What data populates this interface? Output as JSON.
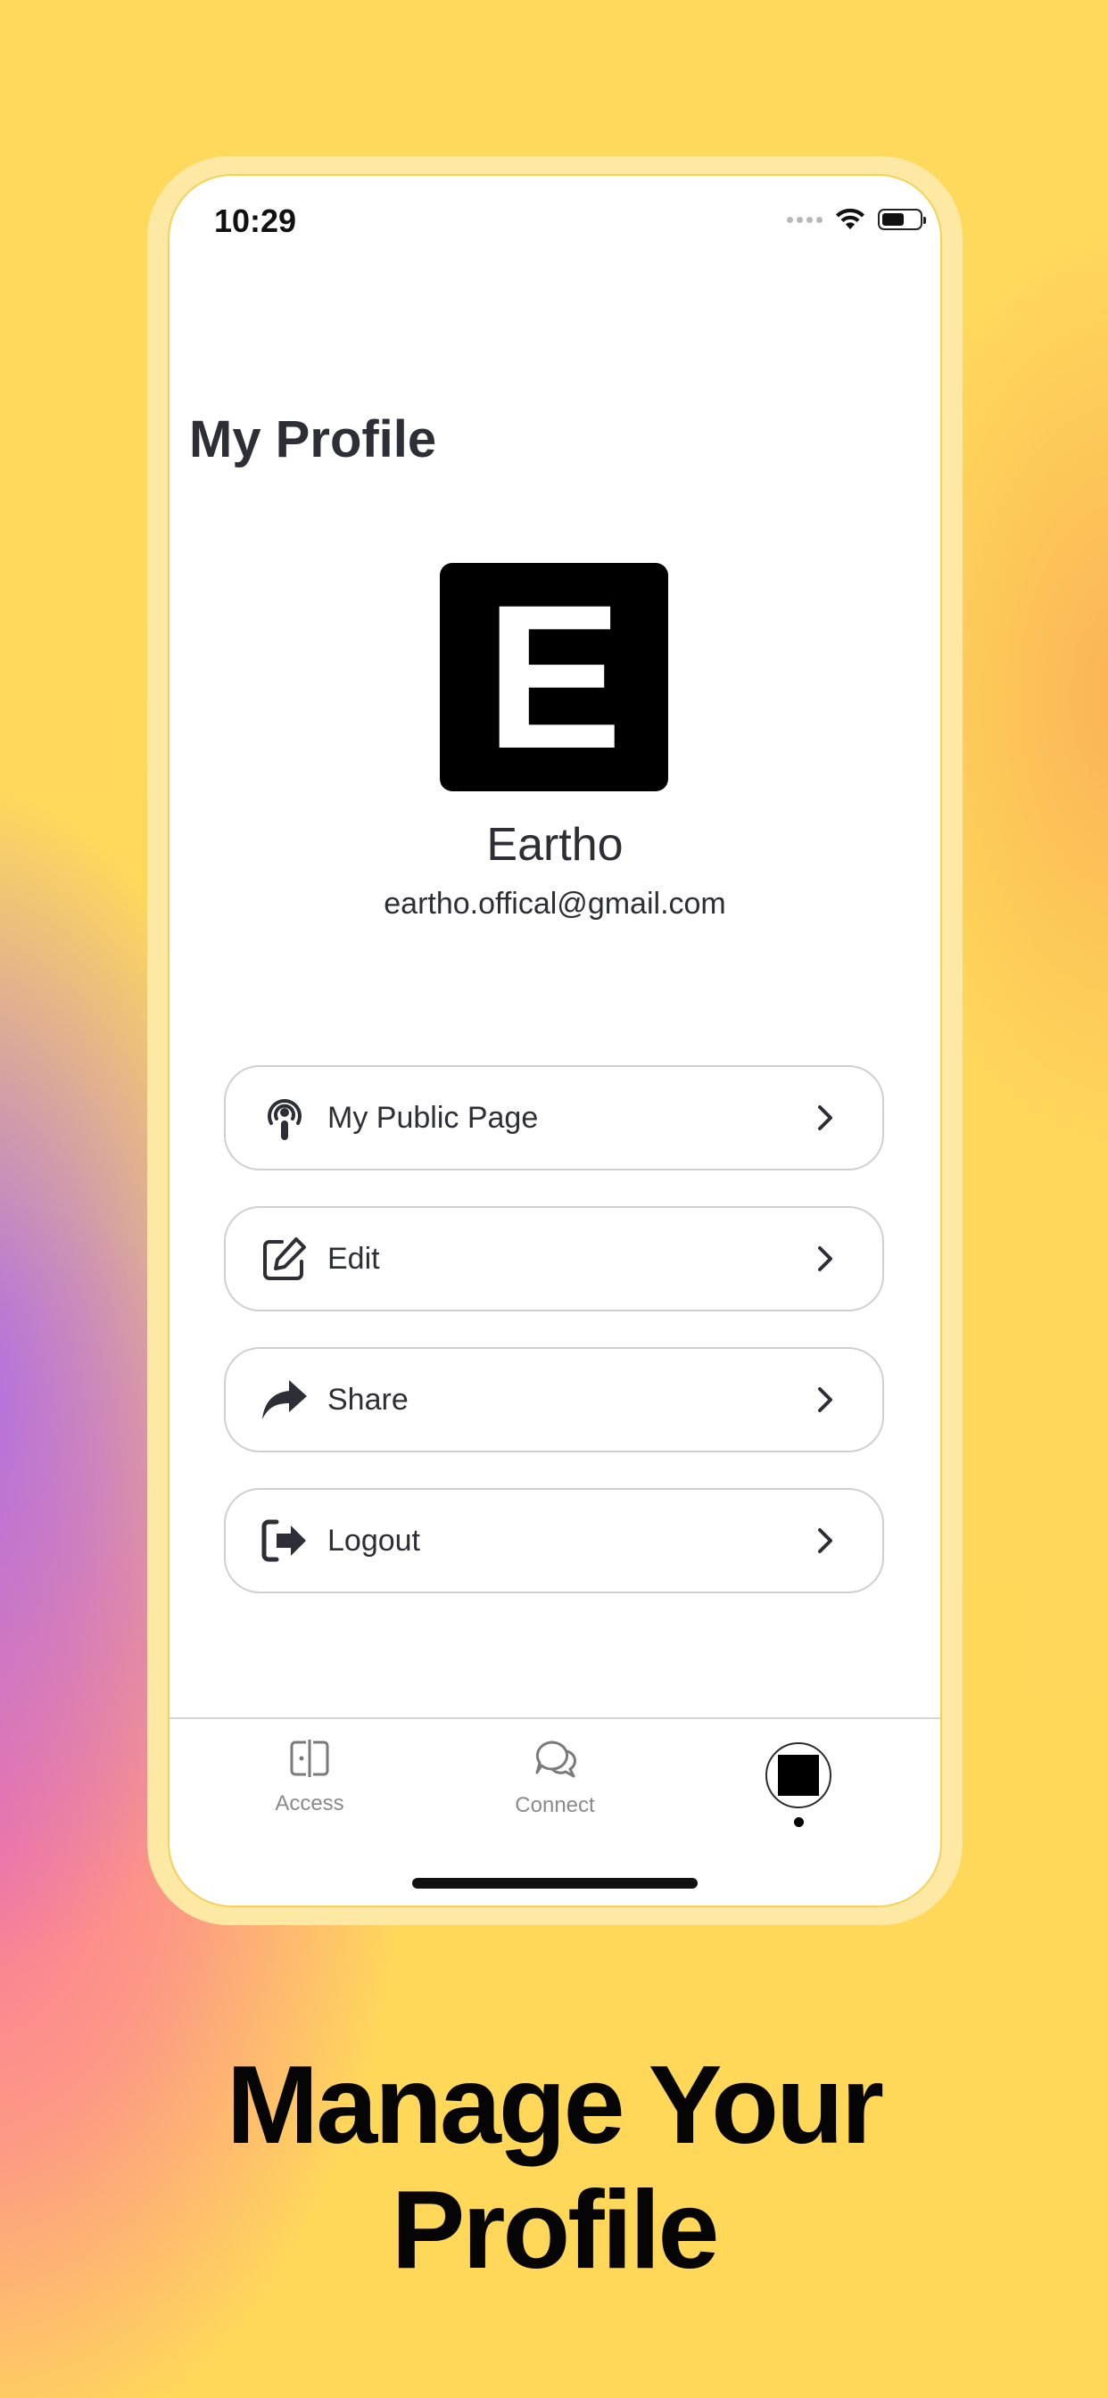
{
  "status_bar": {
    "time": "10:29"
  },
  "page": {
    "title": "My Profile"
  },
  "profile": {
    "avatar_letter": "E",
    "name": "Eartho",
    "email": "eartho.offical@gmail.com"
  },
  "menu": {
    "items": [
      {
        "label": "My Public Page",
        "icon": "podcast-broadcast-icon"
      },
      {
        "label": "Edit",
        "icon": "edit-pencil-icon"
      },
      {
        "label": "Share",
        "icon": "share-arrow-icon"
      },
      {
        "label": "Logout",
        "icon": "logout-icon"
      }
    ]
  },
  "tab_bar": {
    "tabs": [
      {
        "label": "Access",
        "icon": "access-icon"
      },
      {
        "label": "Connect",
        "icon": "chat-bubbles-icon"
      },
      {
        "label": "",
        "icon": "profile-avatar-icon",
        "active": true
      }
    ]
  },
  "headline": {
    "line1": "Manage Your",
    "line2": "Profile"
  },
  "colors": {
    "background": "#ffd95c",
    "text_dark": "#2e2e36",
    "frame": "#fde9a3"
  }
}
